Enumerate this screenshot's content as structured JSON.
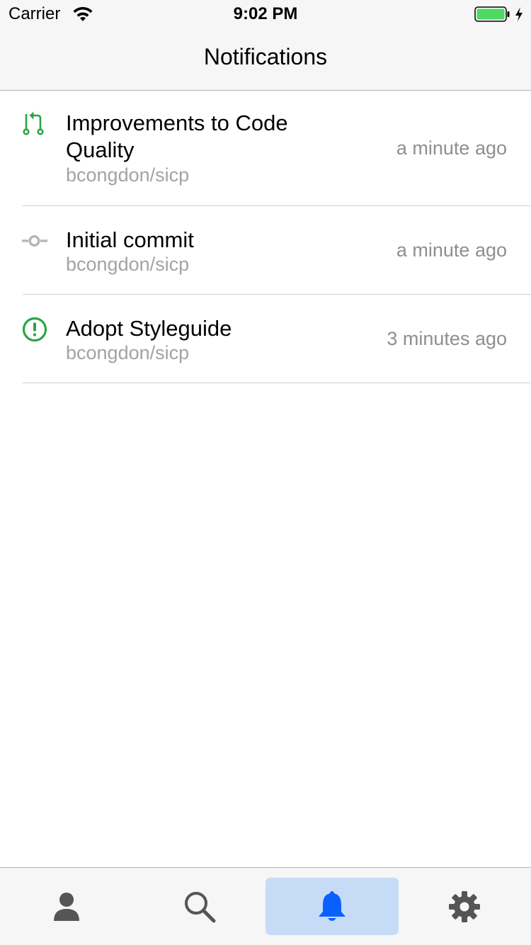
{
  "status_bar": {
    "carrier": "Carrier",
    "time": "9:02 PM",
    "wifi_icon": "wifi-icon",
    "battery_icon": "battery-icon",
    "charging_icon": "charging-bolt-icon",
    "battery_color": "#4cd964"
  },
  "nav": {
    "title": "Notifications"
  },
  "notifications": [
    {
      "icon": "pull-request-icon",
      "icon_color": "#28a745",
      "title": "Improvements to Code Quality",
      "repo": "bcongdon/sicp",
      "time": "a minute ago"
    },
    {
      "icon": "commit-icon",
      "icon_color": "#b5b5b5",
      "title": "Initial commit",
      "repo": "bcongdon/sicp",
      "time": "a minute ago"
    },
    {
      "icon": "issue-icon",
      "icon_color": "#28a745",
      "title": "Adopt Styleguide",
      "repo": "bcongdon/sicp",
      "time": "3 minutes ago"
    }
  ],
  "tab_bar": {
    "tabs": [
      {
        "icon": "person-icon",
        "active": false
      },
      {
        "icon": "search-icon",
        "active": false
      },
      {
        "icon": "bell-icon",
        "active": true
      },
      {
        "icon": "gear-icon",
        "active": false
      }
    ],
    "inactive_color": "#555555",
    "active_color": "#0a60ff",
    "active_background": "#c6dcf6"
  }
}
